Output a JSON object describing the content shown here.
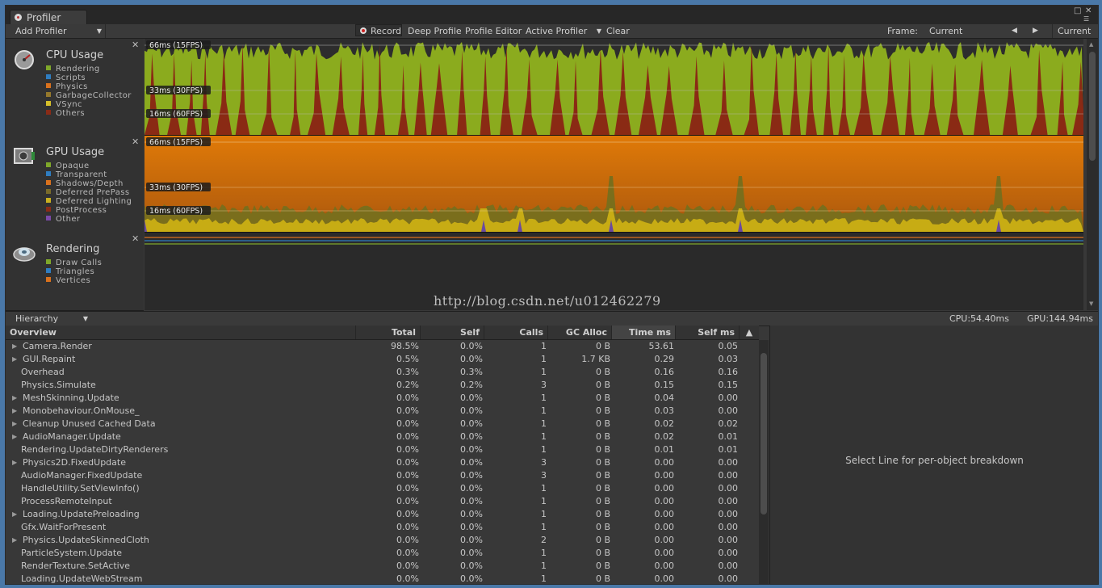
{
  "window": {
    "tab_title": "Profiler"
  },
  "toolbar": {
    "add_profiler": "Add Profiler",
    "record": "Record",
    "deep_profile": "Deep Profile",
    "profile_editor": "Profile Editor",
    "active_profiler": "Active Profiler",
    "clear": "Clear",
    "frame_label": "Frame:",
    "frame_value": "Current",
    "current": "Current"
  },
  "modules": [
    {
      "title": "CPU Usage",
      "icon": "cpu-usage-icon",
      "legend": [
        {
          "label": "Rendering",
          "color": "#7fa82a"
        },
        {
          "label": "Scripts",
          "color": "#2f7dc0"
        },
        {
          "label": "Physics",
          "color": "#d9711d"
        },
        {
          "label": "GarbageCollector",
          "color": "#96792c"
        },
        {
          "label": "VSync",
          "color": "#d6c02a"
        },
        {
          "label": "Others",
          "color": "#8a2b17"
        }
      ]
    },
    {
      "title": "GPU Usage",
      "icon": "gpu-usage-icon",
      "legend": [
        {
          "label": "Opaque",
          "color": "#7fa82a"
        },
        {
          "label": "Transparent",
          "color": "#2f7dc0"
        },
        {
          "label": "Shadows/Depth",
          "color": "#d9711d"
        },
        {
          "label": "Deferred PrePass",
          "color": "#7a6b2a"
        },
        {
          "label": "Deferred Lighting",
          "color": "#c9b020"
        },
        {
          "label": "PostProcess",
          "color": "#8a2b17"
        },
        {
          "label": "Other",
          "color": "#7a4aa8"
        }
      ]
    },
    {
      "title": "Rendering",
      "icon": "rendering-icon",
      "legend": [
        {
          "label": "Draw Calls",
          "color": "#7fa82a"
        },
        {
          "label": "Triangles",
          "color": "#2f7dc0"
        },
        {
          "label": "Vertices",
          "color": "#d9711d"
        }
      ]
    }
  ],
  "graph_labels": {
    "fps15": "66ms (15FPS)",
    "fps30": "33ms (30FPS)",
    "fps60": "16ms (60FPS)"
  },
  "watermark": "http://blog.csdn.net/u012462279",
  "hierarchy": {
    "view_mode": "Hierarchy",
    "cpu_total": "CPU:54.40ms",
    "gpu_total": "GPU:144.94ms",
    "columns": [
      "Overview",
      "Total",
      "Self",
      "Calls",
      "GC Alloc",
      "Time ms",
      "Self ms"
    ],
    "rows": [
      {
        "name": "Camera.Render",
        "expandable": true,
        "total": "98.5%",
        "self": "0.0%",
        "calls": "1",
        "gc": "0 B",
        "time": "53.61",
        "selfms": "0.05"
      },
      {
        "name": "GUI.Repaint",
        "expandable": true,
        "total": "0.5%",
        "self": "0.0%",
        "calls": "1",
        "gc": "1.7 KB",
        "time": "0.29",
        "selfms": "0.03"
      },
      {
        "name": "Overhead",
        "expandable": false,
        "total": "0.3%",
        "self": "0.3%",
        "calls": "1",
        "gc": "0 B",
        "time": "0.16",
        "selfms": "0.16"
      },
      {
        "name": "Physics.Simulate",
        "expandable": false,
        "total": "0.2%",
        "self": "0.2%",
        "calls": "3",
        "gc": "0 B",
        "time": "0.15",
        "selfms": "0.15"
      },
      {
        "name": "MeshSkinning.Update",
        "expandable": true,
        "total": "0.0%",
        "self": "0.0%",
        "calls": "1",
        "gc": "0 B",
        "time": "0.04",
        "selfms": "0.00"
      },
      {
        "name": "Monobehaviour.OnMouse_",
        "expandable": true,
        "total": "0.0%",
        "self": "0.0%",
        "calls": "1",
        "gc": "0 B",
        "time": "0.03",
        "selfms": "0.00"
      },
      {
        "name": "Cleanup Unused Cached Data",
        "expandable": true,
        "total": "0.0%",
        "self": "0.0%",
        "calls": "1",
        "gc": "0 B",
        "time": "0.02",
        "selfms": "0.02"
      },
      {
        "name": "AudioManager.Update",
        "expandable": true,
        "total": "0.0%",
        "self": "0.0%",
        "calls": "1",
        "gc": "0 B",
        "time": "0.02",
        "selfms": "0.01"
      },
      {
        "name": "Rendering.UpdateDirtyRenderers",
        "expandable": false,
        "total": "0.0%",
        "self": "0.0%",
        "calls": "1",
        "gc": "0 B",
        "time": "0.01",
        "selfms": "0.01"
      },
      {
        "name": "Physics2D.FixedUpdate",
        "expandable": true,
        "total": "0.0%",
        "self": "0.0%",
        "calls": "3",
        "gc": "0 B",
        "time": "0.00",
        "selfms": "0.00"
      },
      {
        "name": "AudioManager.FixedUpdate",
        "expandable": false,
        "total": "0.0%",
        "self": "0.0%",
        "calls": "3",
        "gc": "0 B",
        "time": "0.00",
        "selfms": "0.00"
      },
      {
        "name": "HandleUtility.SetViewInfo()",
        "expandable": false,
        "total": "0.0%",
        "self": "0.0%",
        "calls": "1",
        "gc": "0 B",
        "time": "0.00",
        "selfms": "0.00"
      },
      {
        "name": "ProcessRemoteInput",
        "expandable": false,
        "total": "0.0%",
        "self": "0.0%",
        "calls": "1",
        "gc": "0 B",
        "time": "0.00",
        "selfms": "0.00"
      },
      {
        "name": "Loading.UpdatePreloading",
        "expandable": true,
        "total": "0.0%",
        "self": "0.0%",
        "calls": "1",
        "gc": "0 B",
        "time": "0.00",
        "selfms": "0.00"
      },
      {
        "name": "Gfx.WaitForPresent",
        "expandable": false,
        "total": "0.0%",
        "self": "0.0%",
        "calls": "1",
        "gc": "0 B",
        "time": "0.00",
        "selfms": "0.00"
      },
      {
        "name": "Physics.UpdateSkinnedCloth",
        "expandable": true,
        "total": "0.0%",
        "self": "0.0%",
        "calls": "2",
        "gc": "0 B",
        "time": "0.00",
        "selfms": "0.00"
      },
      {
        "name": "ParticleSystem.Update",
        "expandable": false,
        "total": "0.0%",
        "self": "0.0%",
        "calls": "1",
        "gc": "0 B",
        "time": "0.00",
        "selfms": "0.00"
      },
      {
        "name": "RenderTexture.SetActive",
        "expandable": false,
        "total": "0.0%",
        "self": "0.0%",
        "calls": "1",
        "gc": "0 B",
        "time": "0.00",
        "selfms": "0.00"
      },
      {
        "name": "Loading.UpdateWebStream",
        "expandable": false,
        "total": "0.0%",
        "self": "0.0%",
        "calls": "1",
        "gc": "0 B",
        "time": "0.00",
        "selfms": "0.00"
      }
    ]
  },
  "detail": {
    "message": "Select Line for per-object breakdown"
  }
}
